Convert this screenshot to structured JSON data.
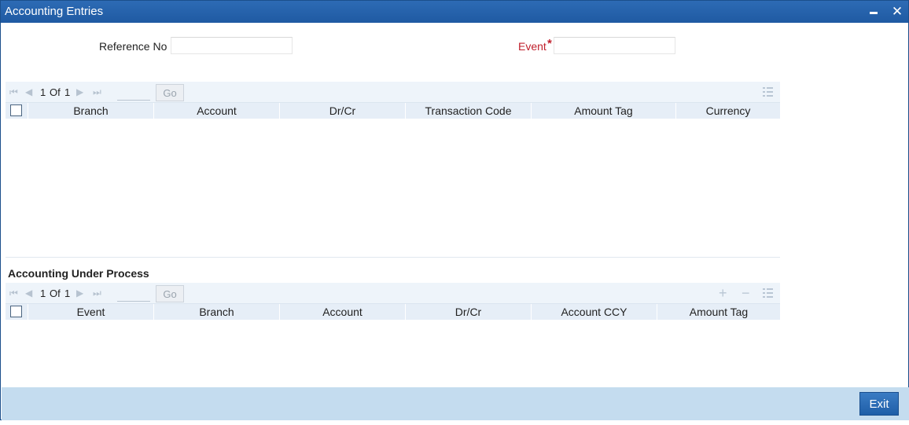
{
  "window": {
    "title": "Accounting Entries"
  },
  "form": {
    "reference_no_label": "Reference No",
    "reference_no_value": "",
    "event_label": "Event",
    "event_required_mark": "*",
    "event_value": ""
  },
  "entries_grid": {
    "page_current": "1",
    "page_of": "Of",
    "page_total": "1",
    "go_label": "Go",
    "columns": [
      "Branch",
      "Account",
      "Dr/Cr",
      "Transaction Code",
      "Amount Tag",
      "Currency"
    ]
  },
  "process_section": {
    "title": "Accounting Under Process",
    "page_current": "1",
    "page_of": "Of",
    "page_total": "1",
    "go_label": "Go",
    "columns": [
      "Event",
      "Branch",
      "Account",
      "Dr/Cr",
      "Account CCY",
      "Amount Tag"
    ]
  },
  "footer": {
    "exit_label": "Exit"
  }
}
